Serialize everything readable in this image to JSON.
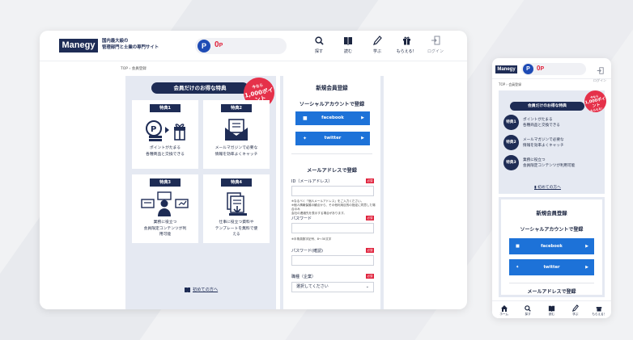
{
  "brand": {
    "logo_text": "Manegy",
    "tagline_line1": "国内最大級の",
    "tagline_line2": "管理部門と士業の専門サイト",
    "colors": {
      "navy": "#1e2c55",
      "red": "#e0223c",
      "sns_blue": "#1d72d8",
      "panel": "#e5e9f2"
    }
  },
  "header": {
    "points_badge": "P",
    "points_value": "0",
    "points_unit": "P",
    "nav": [
      {
        "icon": "search-icon",
        "label": "探す"
      },
      {
        "icon": "book-icon",
        "label": "読む"
      },
      {
        "icon": "pen-icon",
        "label": "学ぶ"
      },
      {
        "icon": "gift-icon",
        "label": "もらえる！"
      },
      {
        "icon": "login-icon",
        "label": "ログイン"
      }
    ]
  },
  "breadcrumb": {
    "top": "TOP",
    "separator": "›",
    "current": "会員登録"
  },
  "benefits": {
    "title": "会員だけのお得な特典",
    "burst_line1": "今なら",
    "burst_line2": "1,000ポイント",
    "burst_line3": "もらえる！",
    "cards": [
      {
        "tag": "特典1",
        "text_line1": "ポイントがたまる",
        "text_line2": "各種商品と交換できる"
      },
      {
        "tag": "特典2",
        "text_line1": "メールマガジンで必要な",
        "text_line2": "情報を効率よくキャッチ"
      },
      {
        "tag": "特典3",
        "text_line1": "業務に役立つ",
        "text_line2": "会員限定コンテンツが利",
        "text_line3": "用可能"
      },
      {
        "tag": "特典4",
        "text_line1": "仕事に役立つ資料や",
        "text_line2": "テンプレートを無料で使",
        "text_line3": "える"
      }
    ],
    "first_time_link": "初めての方へ"
  },
  "registration": {
    "title": "新規会員登録",
    "social_heading": "ソーシャルアカウントで登録",
    "facebook_label": "facebook",
    "twitter_label": "twitter",
    "email_heading": "メールアドレスで登録",
    "required_badge": "必須",
    "id_label": "ID（メールアドレス）",
    "id_note_line1": "※なるべく「個人メールアドレス」をご入力ください。",
    "id_note_line2": "※個人情報保護の観点から、その他利用目的の指定に同意した場合のみ",
    "id_note_line3": "会社の連絡先を表示する場合があります。",
    "password_label": "パスワード",
    "password_note": "※半角英数字記号、8〜30文字",
    "password_confirm_label": "パスワード(確認)",
    "occupation_label": "職種（企業）",
    "occupation_select": "選択してください"
  },
  "mobile": {
    "benefit_items": [
      {
        "num": "特典1",
        "line1": "ポイントがたまる",
        "line2": "各種商品と交換できる"
      },
      {
        "num": "特典2",
        "line1": "メールマガジンで必要な",
        "line2": "情報を効率よくキャッチ"
      },
      {
        "num": "特典3",
        "line1": "業務に役立つ",
        "line2": "会員限定コンテンツが利用可能"
      }
    ],
    "tabbar": [
      {
        "icon": "home-icon",
        "label": "ホーム"
      },
      {
        "icon": "search-icon",
        "label": "探す"
      },
      {
        "icon": "book-icon",
        "label": "読む"
      },
      {
        "icon": "pen-icon",
        "label": "学ぶ"
      },
      {
        "icon": "gift-icon",
        "label": "もらえる！"
      }
    ]
  }
}
